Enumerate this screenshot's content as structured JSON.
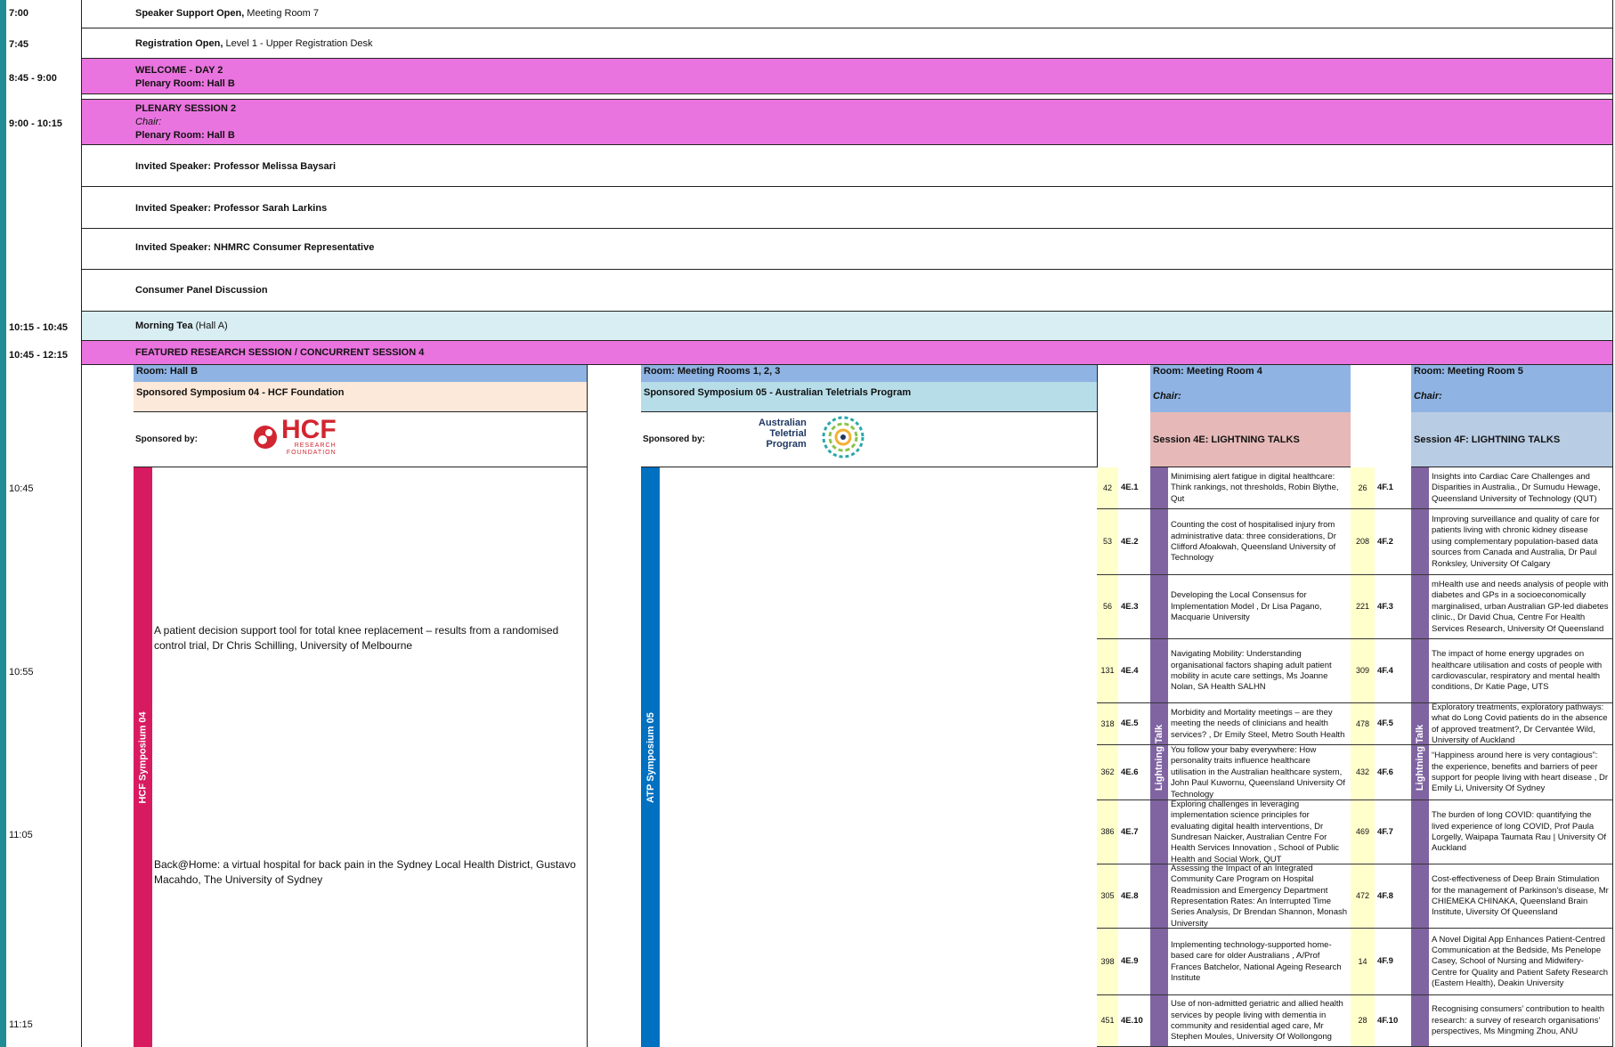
{
  "times": {
    "t0700": "7:00",
    "t0745": "7:45",
    "t0845": "8:45 - 9:00",
    "t0900": "9:00 - 10:15",
    "t1015": "10:15 - 10:45",
    "t1045": "10:45 - 12:15",
    "s1045": "10:45",
    "s1055": "10:55",
    "s1105": "11:05",
    "s1115": "11:15"
  },
  "rows": {
    "speaker_support_bold": "Speaker Support Open,",
    "speaker_support_rest": " Meeting Room 7",
    "registration_bold": "Registration Open,",
    "registration_rest": " Level 1 - Upper Registration Desk",
    "welcome_line1": "WELCOME - DAY 2",
    "welcome_line2": "Plenary Room: Hall B",
    "plenary_line1": "PLENARY SESSION 2",
    "plenary_chair": "Chair:",
    "plenary_room": "Plenary Room: Hall B",
    "invited1": "Invited Speaker: Professor Melissa Baysari",
    "invited2": "Invited Speaker: Professor Sarah Larkins",
    "invited3": "Invited Speaker: NHMRC Consumer Representative",
    "panel": "Consumer Panel Discussion",
    "morning_tea_bold": "Morning Tea",
    "morning_tea_rest": " (Hall A)",
    "featured": "FEATURED RESEARCH SESSION  /  CONCURRENT SESSION 4"
  },
  "hallb": {
    "room": "Room: Hall B",
    "symposium": "Sponsored Symposium 04 - HCF Foundation",
    "sponsored_by": "Sponsored by:",
    "logo_word": "HCF",
    "logo_sub1": "RESEARCH",
    "logo_sub2": "FOUNDATION",
    "vertical": "HCF  Symposium  04",
    "talk1": "A patient decision support tool for total knee replacement – results from a randomised control trial, Dr Chris Schilling, University of Melbourne",
    "talk2": " Back@Home: a virtual hospital for back pain in the Sydney Local Health District, Gustavo Macahdo, The University of Sydney",
    "bar_color": "#d81b60"
  },
  "mr123": {
    "room": "Room: Meeting Rooms 1, 2, 3",
    "symposium": "Sponsored Symposium 05 - Australian Teletrials Program",
    "sponsored_by": "Sponsored by:",
    "logo_line1": "Australian",
    "logo_line2": "Teletrial",
    "logo_line3": "Program",
    "vertical": "ATP  Symposium  05",
    "bar_color": "#0070c0"
  },
  "mr4": {
    "room": "Room: Meeting Room 4",
    "chair": "Chair:",
    "session": "Session 4E: LIGHTNING TALKS",
    "vertical": "Lightning Talk",
    "talks": [
      {
        "num": "42",
        "code": "4E.1",
        "title": "Minimising alert fatigue in digital healthcare: Think rankings, not thresholds,  Robin Blythe, Qut"
      },
      {
        "num": "53",
        "code": "4E.2",
        "title": "Counting the cost of hospitalised injury from administrative data: three considerations, Dr Clifford Afoakwah, Queensland University of Technology"
      },
      {
        "num": "56",
        "code": "4E.3",
        "title": "Developing the Local Consensus for Implementation Model , Dr Lisa Pagano, Macquarie University"
      },
      {
        "num": "131",
        "code": "4E.4",
        "title": "Navigating Mobility: Understanding organisational factors shaping adult patient mobility in acute care settings, Ms Joanne Nolan, SA Health SALHN"
      },
      {
        "num": "318",
        "code": "4E.5",
        "title": "Morbidity and Mortality meetings – are they meeting the needs of clinicians and health services? , Dr Emily Steel, Metro South Health"
      },
      {
        "num": "362",
        "code": "4E.6",
        "title": "You follow your baby everywhere: How personality traits influence healthcare utilisation in the Australian healthcare system,  John Paul Kuwornu, Queensland University Of Technology"
      },
      {
        "num": "386",
        "code": "4E.7",
        "title": "Exploring challenges in leveraging implementation science principles for evaluating digital health interventions, Dr Sundresan Naicker, Australian Centre For Health Services Innovation ,  School of Public Health and Social Work, QUT"
      },
      {
        "num": "305",
        "code": "4E.8",
        "title": "Assessing the Impact of an Integrated Community Care Program on Hospital Readmission and Emergency Department Representation Rates: An Interrupted Time Series Analysis, Dr Brendan Shannon, Monash University"
      },
      {
        "num": "398",
        "code": "4E.9",
        "title": "Implementing technology-supported home-based care for older Australians , A/Prof Frances Batchelor, National Ageing Research Institute"
      },
      {
        "num": "451",
        "code": "4E.10",
        "title": "Use of non-admitted geriatric and allied health services by people living with dementia in community and residential aged care, Mr Stephen Moules, University Of Wollongong"
      }
    ]
  },
  "mr5": {
    "room": "Room: Meeting Room 5",
    "chair": "Chair:",
    "session": "Session 4F: LIGHTNING TALKS",
    "vertical": "Lightning Talk",
    "talks": [
      {
        "num": "26",
        "code": "4F.1",
        "title": "Insights into Cardiac Care Challenges and Disparities in Australia., Dr Sumudu Hewage, Queensland University of Technology (QUT)"
      },
      {
        "num": "208",
        "code": "4F.2",
        "title": "Improving surveillance and quality of care for patients living with chronic kidney disease using complementary population-based data sources from Canada and Australia, Dr Paul Ronksley, University Of Calgary"
      },
      {
        "num": "221",
        "code": "4F.3",
        "title": "mHealth use and needs analysis of people with diabetes and GPs in a socioeconomically marginalised, urban Australian GP-led diabetes clinic., Dr David Chua, Centre For Health Services Research, University Of Queensland"
      },
      {
        "num": "309",
        "code": "4F.4",
        "title": "The impact of home energy upgrades on healthcare utilisation and costs of people with cardiovascular, respiratory and mental health conditions, Dr Katie Page, UTS"
      },
      {
        "num": "478",
        "code": "4F.5",
        "title": "Exploratory treatments, exploratory pathways: what do Long Covid patients do in the absence of approved treatment?, Dr Cervantée Wild, University of Auckland"
      },
      {
        "num": "432",
        "code": "4F.6",
        "title": "“Happiness around here is very contagious”: the experience, benefits and barriers of peer support for people living with heart disease , Dr Emily Li, University Of Sydney"
      },
      {
        "num": "469",
        "code": "4F.7",
        "title": "The burden of long COVID: quantifying the lived experience of long COVID, Prof Paula Lorgelly, Waipapa Taumata Rau | University Of Auckland"
      },
      {
        "num": "472",
        "code": "4F.8",
        "title": "Cost-effectiveness of Deep Brain Stimulation for the management of Parkinson's disease, Mr CHIEMEKA CHINAKA, Queensland Brain Institute, Uiversity Of Queensland"
      },
      {
        "num": "14",
        "code": "4F.9",
        "title": "A Novel Digital App Enhances Patient-Centred Communication at the Bedside, Ms Penelope Casey, School of Nursing and Midwifery- Centre for Quality and Patient Safety Research (Eastern Health), Deakin University"
      },
      {
        "num": "28",
        "code": "4F.10",
        "title": "Recognising consumers’ contribution to health research: a survey of research organisations’ perspectives, Ms Mingming Zhou, ANU"
      }
    ]
  },
  "colors": {
    "pink": "#ea74df",
    "teal": "#1f8c96",
    "purple": "#8064a2",
    "yellow": "#ffffcc"
  }
}
